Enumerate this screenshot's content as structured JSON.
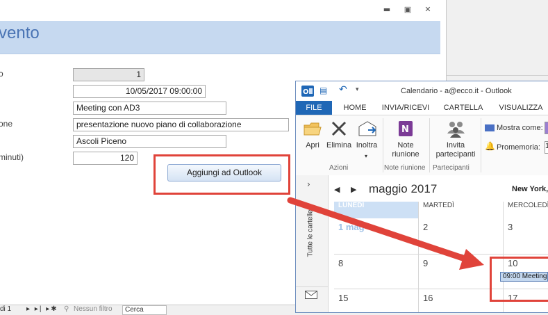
{
  "access": {
    "form_title": "vento",
    "labels": [
      "o",
      "one",
      "minuti)"
    ],
    "fields": {
      "id": "1",
      "datetime": "10/05/2017 09:00:00",
      "subject": "Meeting con AD3",
      "description": "presentazione nuovo piano di collaborazione",
      "location": "Ascoli Piceno",
      "duration": "120"
    },
    "add_button": "Aggiungi ad Outlook",
    "status": {
      "record": "di 1",
      "nav": "▸ ▸| ▸✱",
      "filter": "Nessun filtro",
      "search": "Cerca"
    }
  },
  "outlook": {
    "title": "Calendario - a@ecco.it - Outlook",
    "tabs": [
      "FILE",
      "HOME",
      "INVIA/RICEVI",
      "CARTELLA",
      "VISUALIZZA"
    ],
    "ribbon": {
      "apri": "Apri",
      "elimina": "Elimina",
      "inoltra": "Inoltra",
      "note_line1": "Note",
      "note_line2": "riunione",
      "invita_line1": "Invita",
      "invita_line2": "partecipanti",
      "mostra_come": "Mostra come:",
      "promemoria": "Promemoria:",
      "group_azioni": "Azioni",
      "group_note": "Note riunione",
      "group_partecipanti": "Partecipanti"
    },
    "nav_vertical_text": "Tutte le cartelle",
    "calendar": {
      "month": "maggio 2017",
      "location": "New York,",
      "days": [
        "LUNEDÌ",
        "MARTEDÌ",
        "MERCOLEDÌ"
      ],
      "week1": [
        "1 mag",
        "2",
        "3"
      ],
      "week2": [
        "8",
        "9",
        "10"
      ],
      "week3": [
        "15",
        "16",
        "17"
      ],
      "event": "09:00 Meeting"
    }
  },
  "colors": {
    "header_band": "#c6d9f0",
    "accent": "#1f67b6",
    "highlight_red": "#e0433a"
  }
}
